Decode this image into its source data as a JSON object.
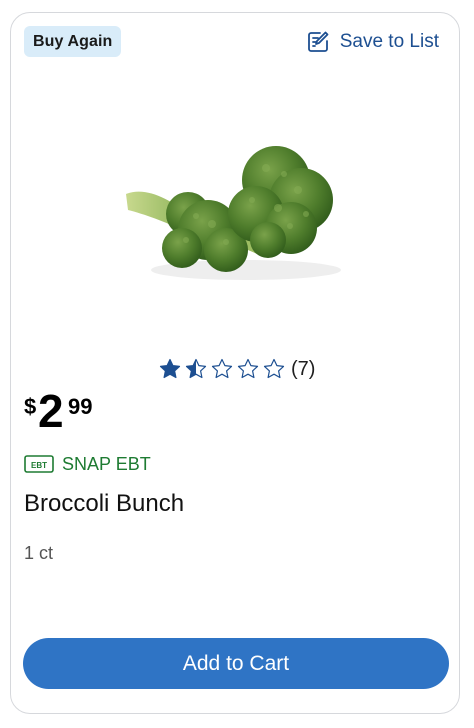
{
  "badge": {
    "label": "Buy Again"
  },
  "save": {
    "label": "Save to List",
    "icon": "edit-list-icon"
  },
  "product": {
    "image_alt": "broccoli",
    "name": "Broccoli Bunch",
    "size": "1 ct"
  },
  "rating": {
    "value": 1.5,
    "max": 5,
    "count_text": "(7)"
  },
  "price": {
    "currency": "$",
    "dollars": "2",
    "cents": "99"
  },
  "snap": {
    "label": "SNAP EBT",
    "icon": "ebt-card-icon"
  },
  "cart": {
    "label": "Add to Cart"
  },
  "colors": {
    "primary": "#2f74c5",
    "link": "#1d4f91",
    "star": "#1d4f91",
    "snap_green": "#1e7b32",
    "badge_bg": "#d9ecf9"
  }
}
